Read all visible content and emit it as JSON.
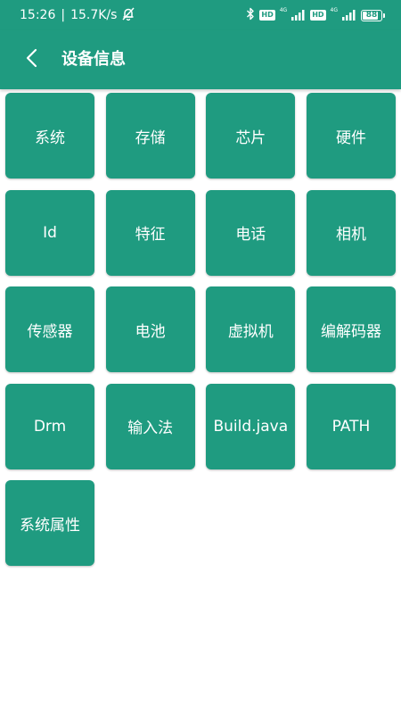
{
  "status_bar": {
    "time": "15:26",
    "network_speed": "15.7K/s",
    "separator": "|",
    "hd1": "HD",
    "net1": "4G",
    "hd2": "HD",
    "net2": "4G",
    "battery_level": "88",
    "battery_fraction": 0.88
  },
  "app_bar": {
    "title": "设备信息",
    "back_icon": "chevron-left-icon"
  },
  "tiles": [
    {
      "label": "系统"
    },
    {
      "label": "存储"
    },
    {
      "label": "芯片"
    },
    {
      "label": "硬件"
    },
    {
      "label": "Id"
    },
    {
      "label": "特征"
    },
    {
      "label": "电话"
    },
    {
      "label": "相机"
    },
    {
      "label": "传感器"
    },
    {
      "label": "电池"
    },
    {
      "label": "虚拟机"
    },
    {
      "label": "编解码器"
    },
    {
      "label": "Drm"
    },
    {
      "label": "输入法"
    },
    {
      "label": "Build.java"
    },
    {
      "label": "PATH"
    },
    {
      "label": "系统属性"
    }
  ],
  "colors": {
    "primary": "#1f9b80",
    "background": "#ffffff",
    "text_on_primary": "#ffffff"
  }
}
